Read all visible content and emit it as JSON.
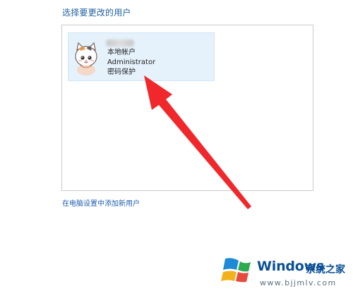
{
  "section": {
    "title": "选择要更改的用户"
  },
  "user_card": {
    "line1": "本地帐户",
    "line2": "Administrator",
    "line3": "密码保护",
    "avatar_icon": "cat-avatar-icon"
  },
  "links": {
    "add_user": "在电脑设置中添加新用户"
  },
  "overlay": {
    "arrow_color": "#f0272b",
    "arrow_icon": "red-arrow-icon"
  },
  "watermark": {
    "brand": "Windows",
    "cn": "系统之家",
    "url": "www.bjjmlv.com",
    "logo_colors": [
      "#1e8ad6",
      "#2eaa4f",
      "#f2b21b",
      "#e64b3c"
    ]
  }
}
